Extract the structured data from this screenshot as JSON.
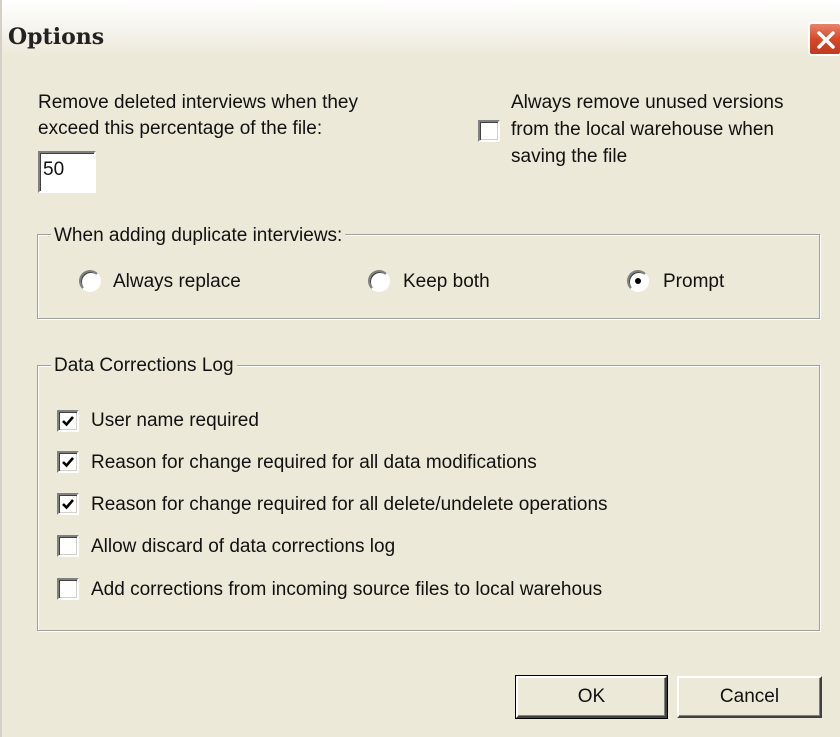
{
  "window": {
    "title": "Options",
    "close_icon": "close-icon"
  },
  "remove_deleted": {
    "label_line1": "Remove deleted interviews when they",
    "label_line2": "exceed this percentage of the file:",
    "value": "50"
  },
  "remove_unused": {
    "checked": false,
    "label_line1": "Always remove unused versions",
    "label_line2": "from the local warehouse when",
    "label_line3": "saving the file"
  },
  "duplicates": {
    "legend": "When adding duplicate interviews:",
    "options": [
      {
        "label": "Always replace",
        "selected": false
      },
      {
        "label": "Keep both",
        "selected": false
      },
      {
        "label": "Prompt",
        "selected": true
      }
    ]
  },
  "corrections_log": {
    "legend": "Data Corrections Log",
    "items": [
      {
        "label": "User name required",
        "checked": true
      },
      {
        "label": "Reason for change required for all data modifications",
        "checked": true
      },
      {
        "label": "Reason for change required for all delete/undelete operations",
        "checked": true
      },
      {
        "label": "Allow discard of data corrections log",
        "checked": false
      },
      {
        "label": "Add corrections from incoming source files to local warehous",
        "checked": false
      }
    ]
  },
  "buttons": {
    "ok": "OK",
    "cancel": "Cancel"
  }
}
